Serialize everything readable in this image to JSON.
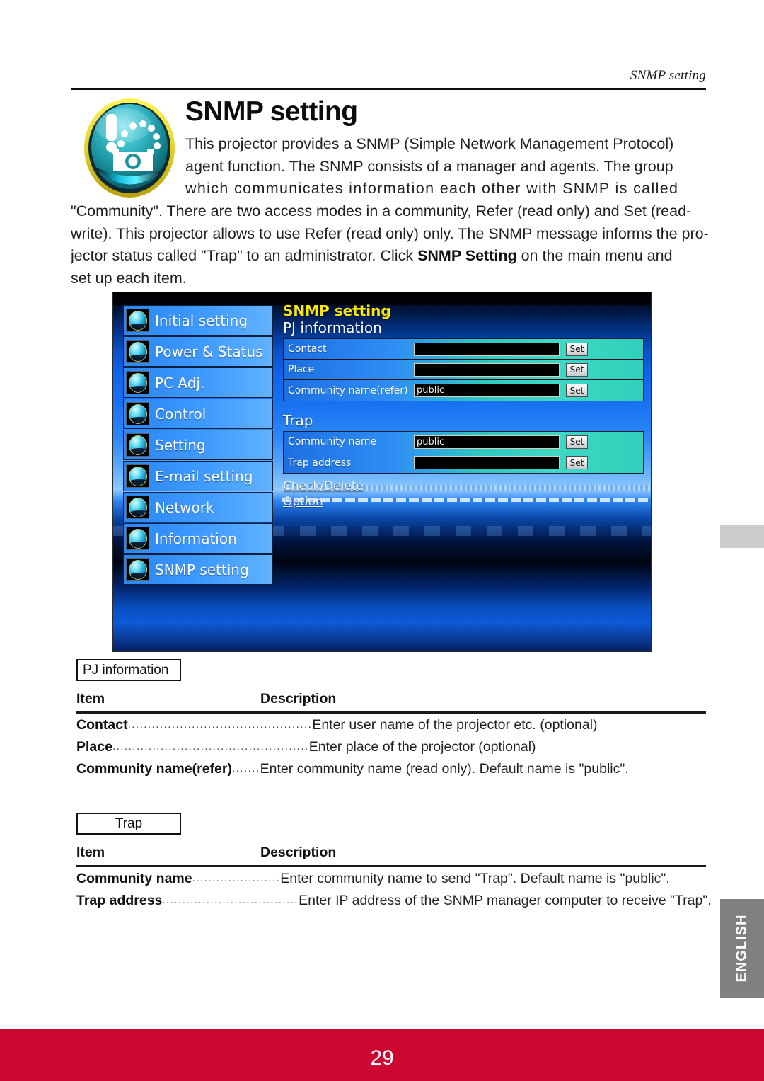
{
  "header": {
    "running_title": "SNMP setting"
  },
  "title": {
    "text": "SNMP setting",
    "icon": "projector-alert-icon"
  },
  "intro": {
    "line1": "This projector provides a SNMP (Simple Network Management Protocol)",
    "line2": "agent function. The SNMP consists of a manager and agents. The group",
    "line3": "which communicates information each other with SNMP is called",
    "line4": "\"Community\". There are two access modes in a community, Refer (read only) and Set (read-",
    "line5": "write). This projector allows to use Refer (read only) only. The SNMP message informs the pro-",
    "line6_a": "jector status called \"Trap\" to an administrator. Click ",
    "line6_b": "SNMP Setting",
    "line6_c": " on the main menu and",
    "line7": "set up each item."
  },
  "screenshot": {
    "menu": [
      {
        "label": "Initial setting",
        "icon": "orb-initial-icon"
      },
      {
        "label": "Power & Status",
        "icon": "orb-power-icon"
      },
      {
        "label": "PC Adj.",
        "icon": "orb-pcadj-icon"
      },
      {
        "label": "Control",
        "icon": "orb-control-icon"
      },
      {
        "label": "Setting",
        "icon": "orb-setting-icon"
      },
      {
        "label": "E-mail setting",
        "icon": "orb-email-icon"
      },
      {
        "label": "Network",
        "icon": "orb-network-icon"
      },
      {
        "label": "Information",
        "icon": "orb-information-icon"
      },
      {
        "label": "SNMP setting",
        "icon": "orb-snmp-icon"
      }
    ],
    "form": {
      "title": "SNMP setting",
      "title_color": "#ffe500",
      "section_pj": "PJ information",
      "section_trap": "Trap",
      "set_label": "Set",
      "pj_rows": [
        {
          "label": "Contact",
          "value": ""
        },
        {
          "label": "Place",
          "value": ""
        },
        {
          "label": "Community name(refer)",
          "value": "public"
        }
      ],
      "trap_rows": [
        {
          "label": "Community name",
          "value": "public"
        },
        {
          "label": "Trap address",
          "value": ""
        }
      ],
      "links": [
        "Check/Delete",
        "Option"
      ]
    }
  },
  "tables": [
    {
      "tag": "PJ information",
      "col_item": "Item",
      "col_description": "Description",
      "rows": [
        {
          "item": "Contact",
          "leader": "..............................................",
          "desc": "Enter user name of the projector etc. (optional)"
        },
        {
          "item": "Place",
          "leader": " .................................................",
          "desc": "Enter place of the projector (optional)"
        },
        {
          "item": "Community name(refer)",
          "leader": ".......",
          "desc": "Enter community name (read only). Default name is \"public\"."
        }
      ]
    },
    {
      "tag": "Trap",
      "col_item": "Item",
      "col_description": "Description",
      "rows": [
        {
          "item": "Community name",
          "leader": "......................",
          "desc": "Enter community name to send \"Trap\". Default name is \"public\"."
        },
        {
          "item": "Trap address",
          "leader": "..................................",
          "desc": "Enter IP address of the SNMP manager computer to receive \"Trap\"."
        }
      ]
    }
  ],
  "margin": {
    "gray_tab": "",
    "english_tab": "ENGLISH"
  },
  "footer": {
    "page_number": "29",
    "band_color": "#ce0632"
  }
}
